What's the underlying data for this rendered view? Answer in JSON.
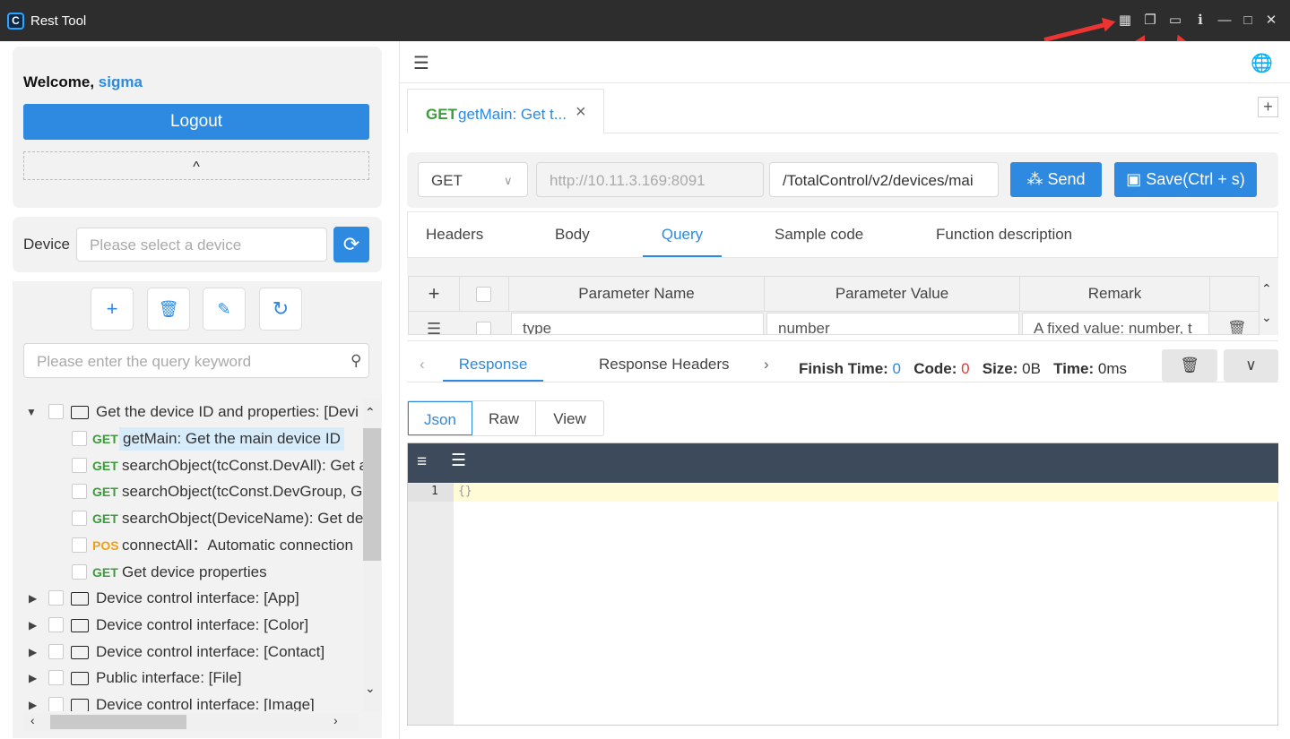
{
  "app": {
    "title": "Rest Tool",
    "logo_letter": "C"
  },
  "window_controls": [
    {
      "name": "qrcode-icon",
      "glyph": "▦"
    },
    {
      "name": "copy-window-icon",
      "glyph": "❐"
    },
    {
      "name": "browser-window-icon",
      "glyph": "▭"
    },
    {
      "name": "info-icon",
      "glyph": "ℹ"
    },
    {
      "name": "minimize-icon",
      "glyph": "—"
    },
    {
      "name": "maximize-icon",
      "glyph": "□"
    },
    {
      "name": "close-icon",
      "glyph": "✕"
    }
  ],
  "user": {
    "welcome": "Welcome,",
    "name": "sigma",
    "logout": "Logout",
    "collapse_glyph": "^"
  },
  "device": {
    "label": "Device",
    "placeholder": "Please select a device"
  },
  "search": {
    "placeholder": "Please enter the query keyword"
  },
  "tree": {
    "root": "Get the device ID and properties: [Devi",
    "children": [
      {
        "method": "GET",
        "label": "getMain: Get the main device ID"
      },
      {
        "method": "GET",
        "label": "searchObject(tcConst.DevAll): Get a"
      },
      {
        "method": "GET",
        "label": "searchObject(tcConst.DevGroup, G"
      },
      {
        "method": "GET",
        "label": "searchObject(DeviceName): Get de"
      },
      {
        "method": "POS",
        "label": "connectAll：Automatic connection"
      },
      {
        "method": "GET",
        "label": "Get device properties"
      }
    ],
    "folders": [
      "Device control interface: [App]",
      "Device control interface: [Color]",
      "Device control interface: [Contact]",
      "Public interface: [File]",
      "Device control interface: [Image]"
    ]
  },
  "request_tab": {
    "method": "GET",
    "label": "getMain: Get t...",
    "close": "×"
  },
  "request": {
    "method": "GET",
    "base_url": "http://10.11.3.169:8091",
    "path": "/TotalControl/v2/devices/mai",
    "send": "Send",
    "save": "Save(Ctrl + s)"
  },
  "req_tabs": [
    "Headers",
    "Body",
    "Query",
    "Sample code",
    "Function description"
  ],
  "active_req_tab": "Query",
  "params_table": {
    "columns": [
      "Parameter Name",
      "Parameter Value",
      "Remark"
    ],
    "row": {
      "name": "type",
      "value": "number",
      "remark": "A fixed value: number, t"
    }
  },
  "response": {
    "tabs": [
      "Response",
      "Response Headers"
    ],
    "finish_time_label": "Finish Time:",
    "finish_time": "0",
    "code_label": "Code:",
    "code": "0",
    "size_label": "Size:",
    "size": "0B",
    "time_label": "Time:",
    "time": "0ms",
    "view_tabs": [
      "Json",
      "Raw",
      "View"
    ],
    "line_number": "1",
    "body": "{}"
  },
  "colors": {
    "accent": "#2d8ae0",
    "get": "#3c9c3c",
    "post": "#f0a010",
    "editor_toolbar": "#3c4a5c",
    "highlight": "#fffbd6"
  }
}
